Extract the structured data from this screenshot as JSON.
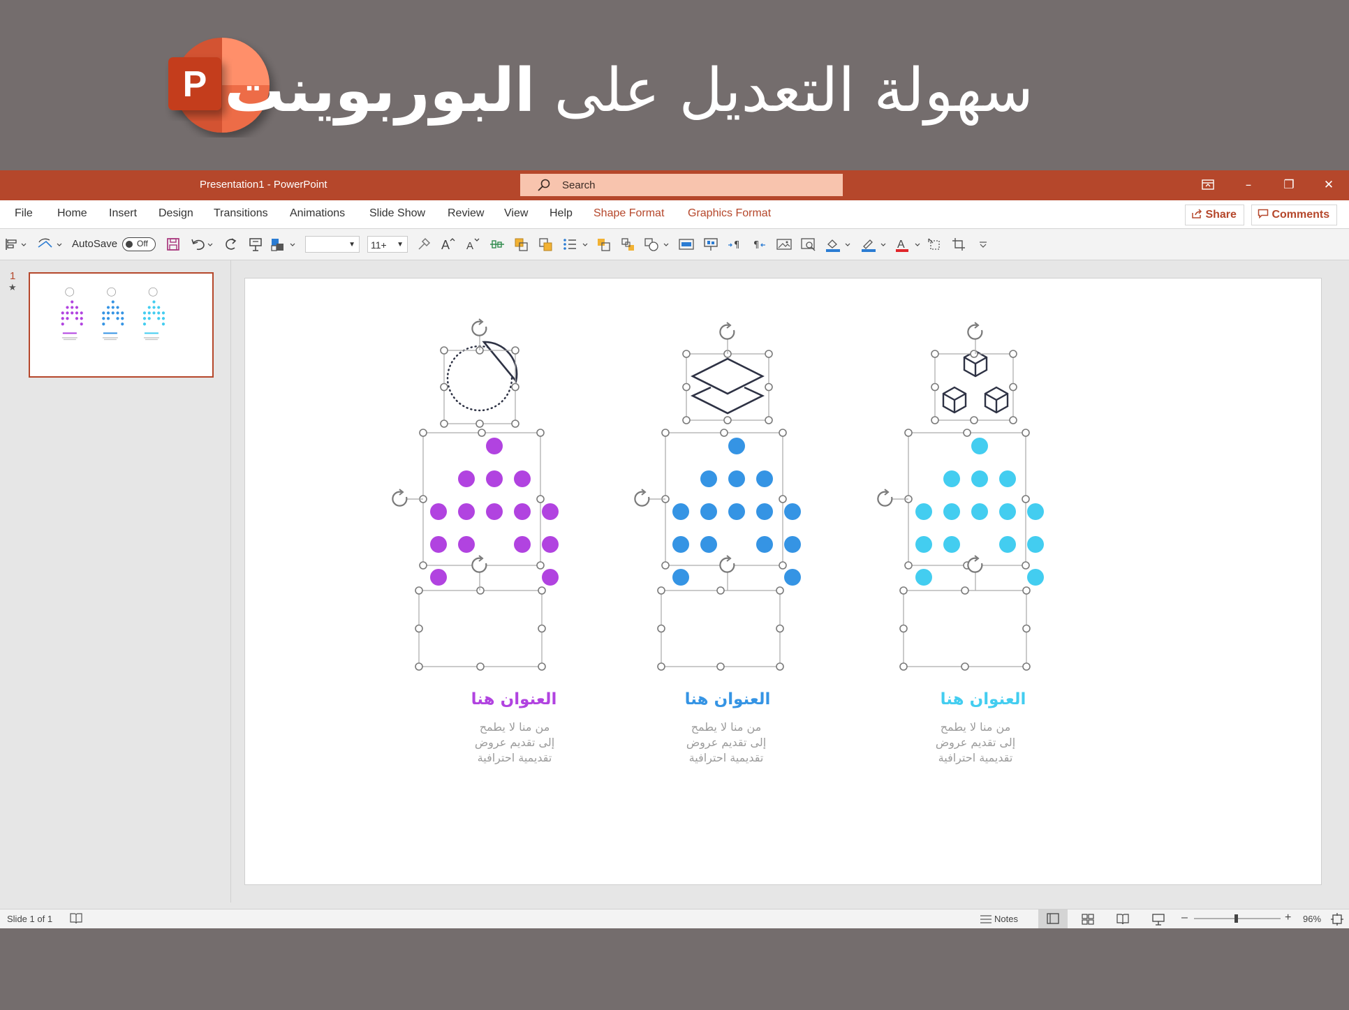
{
  "banner": {
    "headline_regular": "سهولة التعديل على",
    "headline_bold": "البوربوينت",
    "logo_letter": "P"
  },
  "window": {
    "doc_title": "Presentation1  -  PowerPoint",
    "search_placeholder": "Search",
    "controls": {
      "ribbon_display_icon": "ribbon-display-icon",
      "minimize": "–",
      "restore": "❐",
      "close": "✕"
    }
  },
  "menu": {
    "tabs": [
      "File",
      "Home",
      "Insert",
      "Design",
      "Transitions",
      "Animations",
      "Slide Show",
      "Review",
      "View",
      "Help",
      "Shape Format",
      "Graphics Format"
    ],
    "share_label": "Share",
    "comments_label": "Comments"
  },
  "toolbar": {
    "autosave_label": "AutoSave",
    "autosave_state": "Off",
    "font_name": "",
    "font_size": "11+"
  },
  "thumbnails": [
    {
      "number": "1",
      "star": "★"
    }
  ],
  "slide": {
    "columns": [
      {
        "title": "العنوان هنا",
        "body": "من منا لا يطمح إلى تقديم عروض تقديمية احترافية",
        "color": "#b143e0",
        "icon": "pie-chart-icon"
      },
      {
        "title": "العنوان هنا",
        "body": "من منا لا يطمح إلى تقديم عروض تقديمية احترافية",
        "color": "#3594e4",
        "icon": "layers-icon"
      },
      {
        "title": "العنوان هنا",
        "body": "من منا لا يطمح إلى تقديم عروض تقديمية احترافية",
        "color": "#43cdf0",
        "icon": "cubes-icon"
      }
    ]
  },
  "status": {
    "slide_counter": "Slide 1 of 1",
    "notes_label": "Notes",
    "zoom_minus": "–",
    "zoom_plus": "+",
    "zoom_level": "96%"
  }
}
